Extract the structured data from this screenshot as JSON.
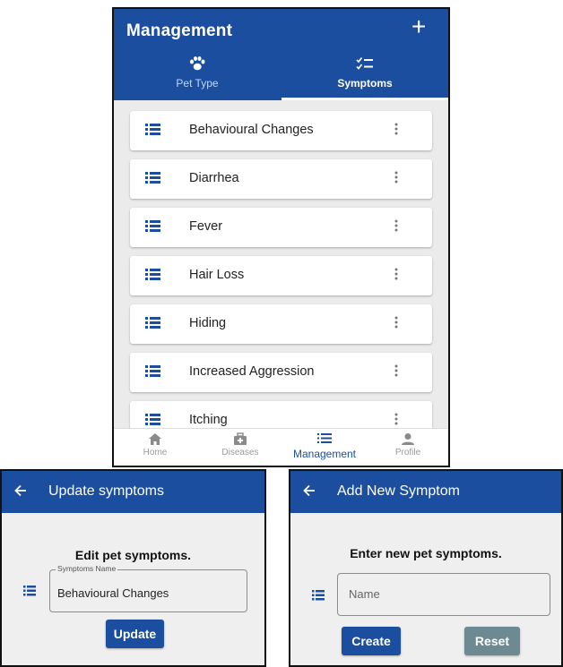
{
  "management_screen": {
    "title": "Management",
    "add_icon": "plus-icon",
    "tabs": [
      {
        "label": "Pet Type",
        "icon": "paw-icon",
        "active": false
      },
      {
        "label": "Symptoms",
        "icon": "checklist-icon",
        "active": true
      }
    ],
    "symptoms": [
      "Behavioural Changes",
      "Diarrhea",
      "Fever",
      "Hair Loss",
      "Hiding",
      "Increased Aggression",
      "Itching"
    ],
    "bottom_nav": [
      {
        "label": "Home",
        "icon": "home-icon",
        "active": false
      },
      {
        "label": "Diseases",
        "icon": "medical-kit-icon",
        "active": false
      },
      {
        "label": "Management",
        "icon": "list-icon",
        "active": true
      },
      {
        "label": "Profile",
        "icon": "person-icon",
        "active": false
      }
    ]
  },
  "update_screen": {
    "title": "Update symptoms",
    "heading": "Edit pet symptoms.",
    "field_label": "Symptoms Name",
    "field_value": "Behavioural Changes",
    "button_label": "Update"
  },
  "add_screen": {
    "title": "Add New Symptom",
    "heading": "Enter new pet symptoms.",
    "field_placeholder": "Name",
    "create_label": "Create",
    "reset_label": "Reset"
  },
  "colors": {
    "primary": "#1c4ea0",
    "secondary_button": "#6d8a93",
    "background": "#ebebeb"
  }
}
